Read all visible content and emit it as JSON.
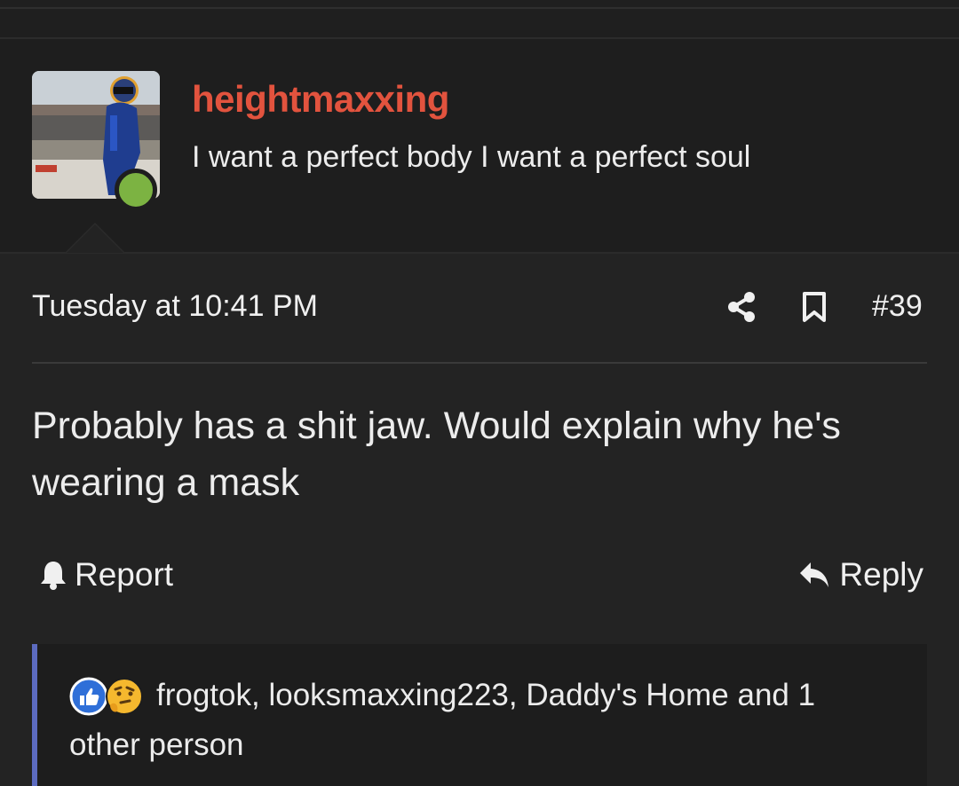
{
  "user": {
    "name": "heightmaxxing",
    "title": "I want a perfect body I want a perfect soul",
    "online": true,
    "name_color": "#e2533e",
    "online_color": "#7cb342"
  },
  "post": {
    "date": "Tuesday at 10:41 PM",
    "number": "#39",
    "body": "Probably has a shit jaw. Would explain why he's wearing a mask",
    "actions": {
      "share_icon": "share-icon",
      "bookmark_icon": "bookmark-icon",
      "report_label": "Report",
      "reply_label": "Reply"
    }
  },
  "reactions": {
    "icons": [
      "like-icon",
      "thinking-face-icon"
    ],
    "text": "frogtok, looksmaxxing223, Daddy's Home and 1 other person",
    "accent_color": "#5c6bc0"
  }
}
